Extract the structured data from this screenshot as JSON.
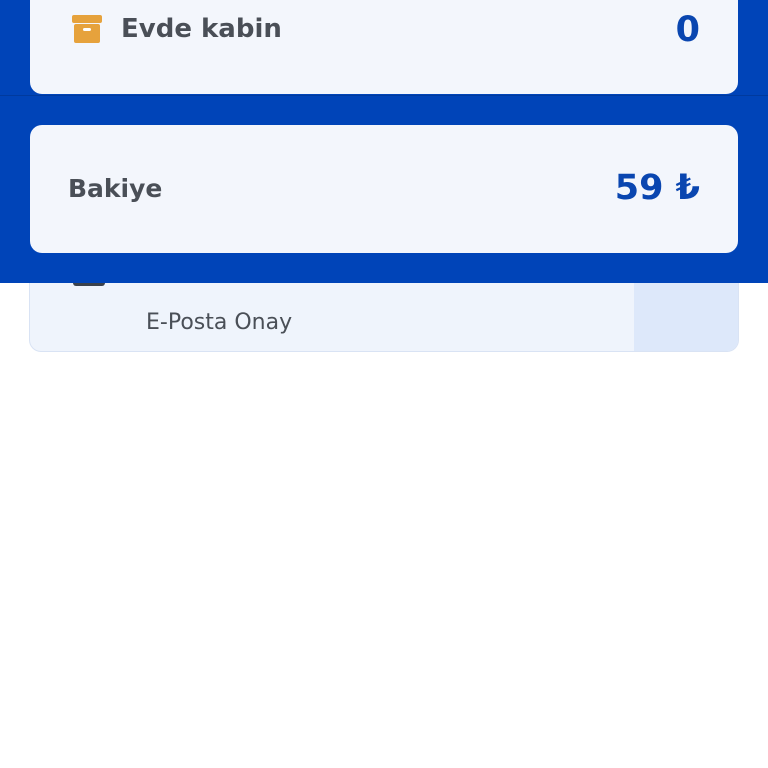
{
  "summary": {
    "evde_kabin": {
      "icon": "archive-box-icon",
      "icon_color": "#E6A23C",
      "label": "Evde kabin",
      "value": "0"
    }
  },
  "balance": {
    "label": "Bakiye",
    "value": "59 ₺"
  },
  "email_confirmation": {
    "subtitle": "E-Posta Onay"
  },
  "colors": {
    "primary": "#0044B8",
    "card_bg": "#F3F6FC",
    "value_text": "#0A46B0",
    "label_text": "#4A4F57",
    "accent_orange": "#E6A23C"
  }
}
